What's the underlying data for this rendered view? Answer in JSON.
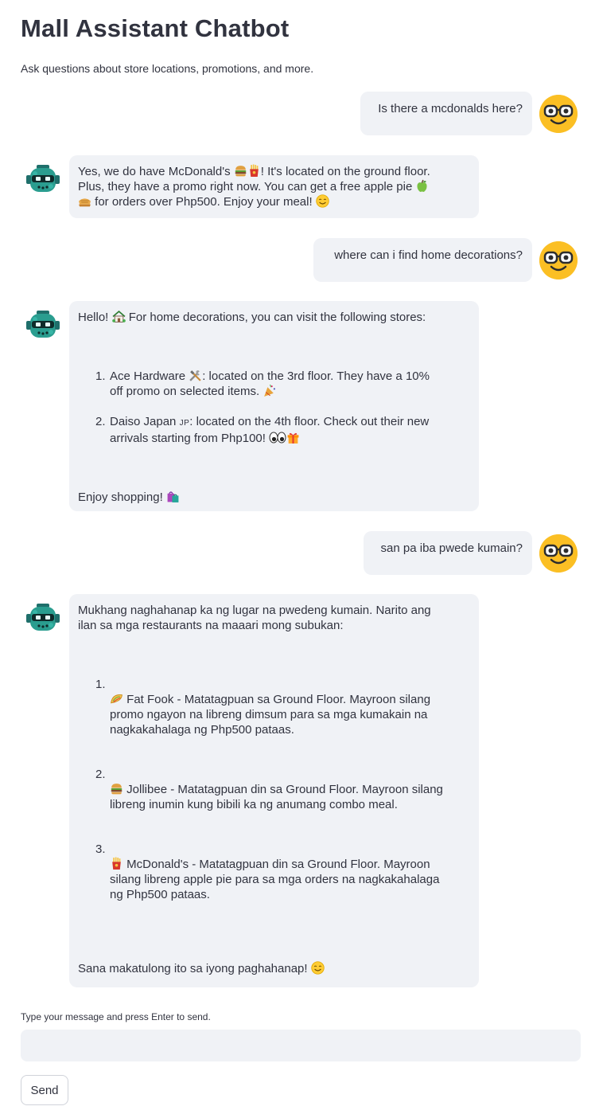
{
  "header": {
    "title": "Mall Assistant Chatbot",
    "subtitle": "Ask questions about store locations, promotions, and more."
  },
  "chat": {
    "messages": [
      {
        "role": "user",
        "text": "Is there a mcdonalds here?"
      },
      {
        "role": "assistant",
        "line1": "Yes, we do have McDonald's",
        "line1_after": "! It's located on the ground floor.",
        "line2": "Plus, they have a promo right now. You can get a free apple pie",
        "line3": "for orders over Php500. Enjoy your meal!"
      },
      {
        "role": "user",
        "text": "where can i find home decorations?"
      },
      {
        "role": "assistant",
        "intro_a": "Hello!",
        "intro_b": "For home decorations, you can visit the following stores:",
        "items": [
          {
            "num": "1.",
            "text_a": "Ace Hardware",
            "text_b": ": located on the 3rd floor. They have a 10%",
            "text_c": "off promo on selected items."
          },
          {
            "num": "2.",
            "text_a": "Daiso Japan",
            "flag": "JP",
            "text_b": ": located on the 4th floor. Check out their new",
            "text_c": "arrivals starting from Php100!"
          }
        ],
        "outro": "Enjoy shopping!"
      },
      {
        "role": "user",
        "text": "san pa iba pwede kumain?"
      },
      {
        "role": "assistant",
        "intro_1": "Mukhang naghahanap ka ng lugar na pwedeng kumain. Narito ang",
        "intro_2": "ilan sa mga restaurants na maaari mong subukan:",
        "items": [
          {
            "num": "1.",
            "l1": "Fat Fook - Matatagpuan sa Ground Floor. Mayroon silang",
            "l2": "promo ngayon na libreng dimsum para sa mga kumakain na",
            "l3": "nagkakahalaga ng Php500 pataas."
          },
          {
            "num": "2.",
            "l1": "Jollibee - Matatagpuan din sa Ground Floor. Mayroon silang",
            "l2": "libreng inumin kung bibili ka ng anumang combo meal."
          },
          {
            "num": "3.",
            "l1": "McDonald's - Matatagpuan din sa Ground Floor. Mayroon",
            "l2": "silang libreng apple pie para sa mga orders na nagkakahalaga",
            "l3": "ng Php500 pataas."
          }
        ],
        "outro": "Sana makatulong ito sa iyong paghahanap!"
      }
    ]
  },
  "input": {
    "label": "Type your message and press Enter to send.",
    "value": "",
    "placeholder": ""
  },
  "send_button": {
    "label": "Send"
  },
  "colors": {
    "bubble": "#f0f2f6",
    "text": "#31333f",
    "user_avatar": "#fbbf24",
    "bot_avatar": "#2a9d8f"
  },
  "icons": {
    "user_avatar": "smiley-with-glasses-icon",
    "bot_avatar": "robot-icon"
  }
}
